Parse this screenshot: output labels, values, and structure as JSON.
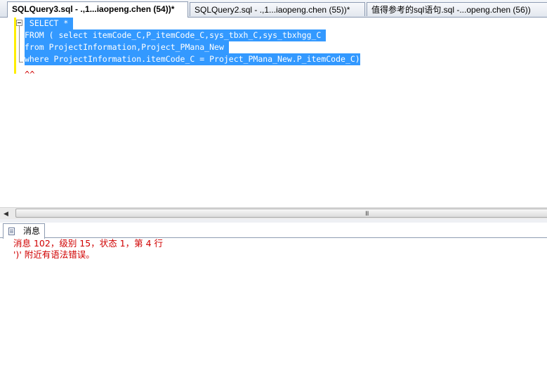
{
  "tabs": [
    {
      "label": "SQLQuery3.sql - .,1...iaopeng.chen (54))*",
      "active": true
    },
    {
      "label": "SQLQuery2.sql - .,1...iaopeng.chen (55))*",
      "active": false
    },
    {
      "label": "值得参考的sql语句.sql -...openg.chen (56))",
      "active": false
    }
  ],
  "editor": {
    "lines": [
      " SELECT * ",
      "FROM ( select itemCode_C,P_itemCode_C,sys_tbxh_C,sys_tbxhgg_C ",
      "from ProjectInformation,Project_PMana_New ",
      "where ProjectInformation.itemCode_C = Project_PMana_New.P_itemCode_C)"
    ],
    "error_marker": "^^"
  },
  "scrollbar": {
    "grip": "III"
  },
  "results": {
    "tab_label": "消息",
    "messages": [
      "消息 102，级别 15，状态 1，第 4 行",
      "')' 附近有语法错误。"
    ]
  },
  "colors": {
    "selection": "#3399ff",
    "error_text": "#d00000",
    "change_bar": "#ffee00"
  }
}
